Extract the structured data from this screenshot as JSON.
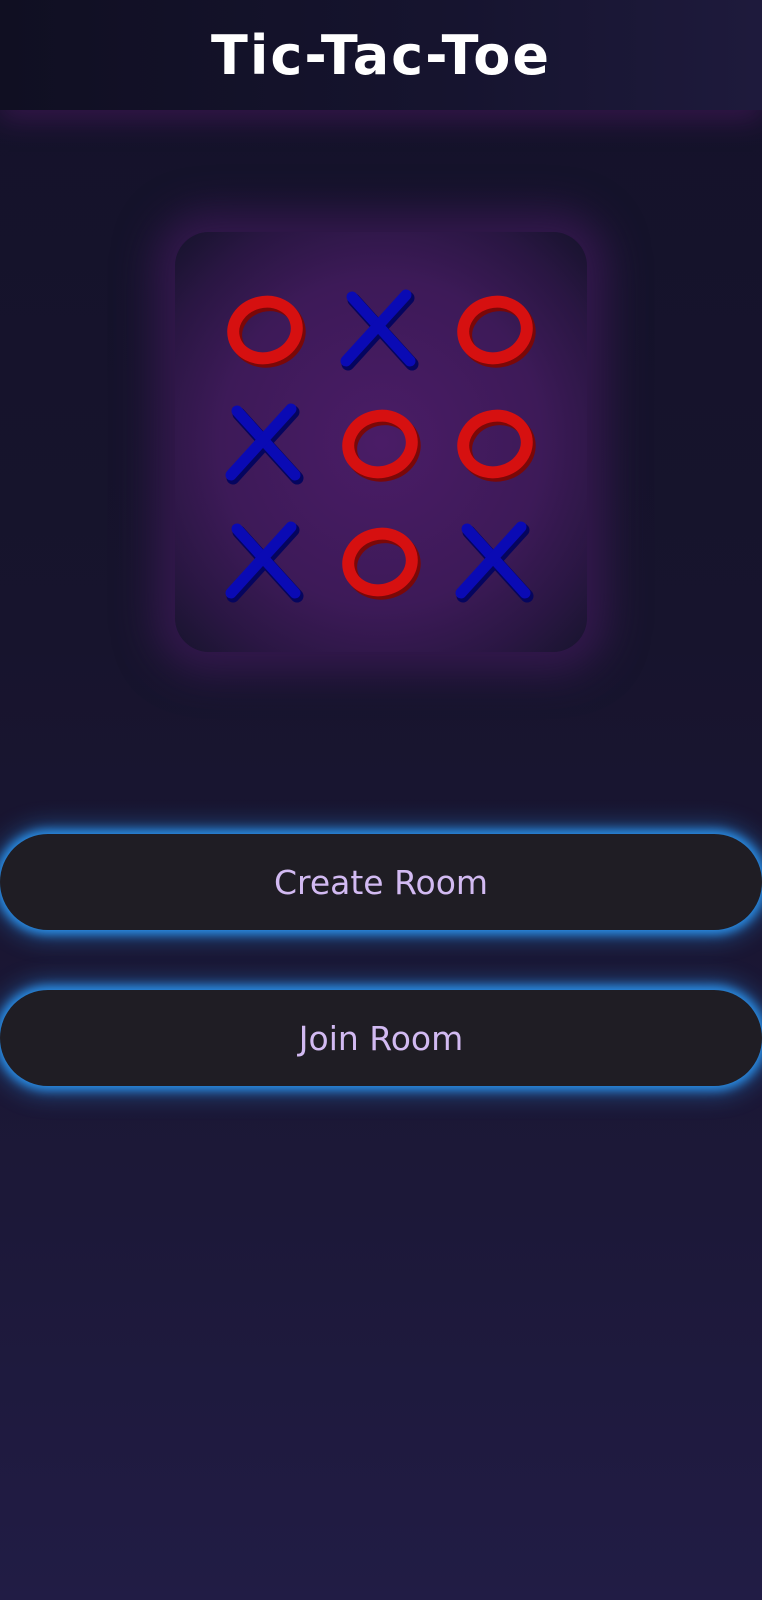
{
  "app_bar": {
    "title": "Tic-Tac-Toe"
  },
  "logo": {
    "board": [
      [
        "O",
        "X",
        "O"
      ],
      [
        "X",
        "O",
        "O"
      ],
      [
        "X",
        "O",
        "X"
      ]
    ],
    "colors": {
      "o_mark": "#d61010",
      "x_mark": "#0a0ab4",
      "panel": "#3d1a58"
    }
  },
  "actions": {
    "create_room_label": "Create Room",
    "join_room_label": "Join Room"
  },
  "colors": {
    "button_bg": "#1f1d24",
    "button_glow": "#2a8fe8",
    "button_text": "#d2baf2"
  }
}
